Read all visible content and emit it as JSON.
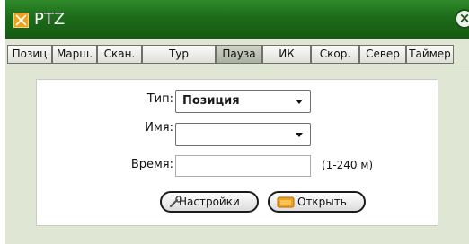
{
  "window": {
    "title": "PTZ",
    "close_symbol": "×",
    "title_icon": "ptz-crosshair-icon",
    "titlebar_color": "#1d6b1a"
  },
  "tabs": [
    {
      "label": "Позиц",
      "active": false
    },
    {
      "label": "Марш.",
      "active": false
    },
    {
      "label": "Скан.",
      "active": false
    },
    {
      "label": "Тур",
      "active": false
    },
    {
      "label": "Пауза",
      "active": true
    },
    {
      "label": "ИК",
      "active": false
    },
    {
      "label": "Скор.",
      "active": false
    },
    {
      "label": "Север",
      "active": false
    },
    {
      "label": "Таймер",
      "active": false
    }
  ],
  "form": {
    "type_label": "Тип:",
    "type_value": "Позиция",
    "name_label": "Имя:",
    "name_value": "",
    "time_label": "Время:",
    "time_value": "",
    "time_hint": "(1-240 м)"
  },
  "buttons": {
    "settings_label": "Настройки",
    "settings_icon": "wrench-icon",
    "open_label": "Открыть",
    "open_icon": "folder-icon",
    "open_icon_color": "#f2a11a"
  }
}
